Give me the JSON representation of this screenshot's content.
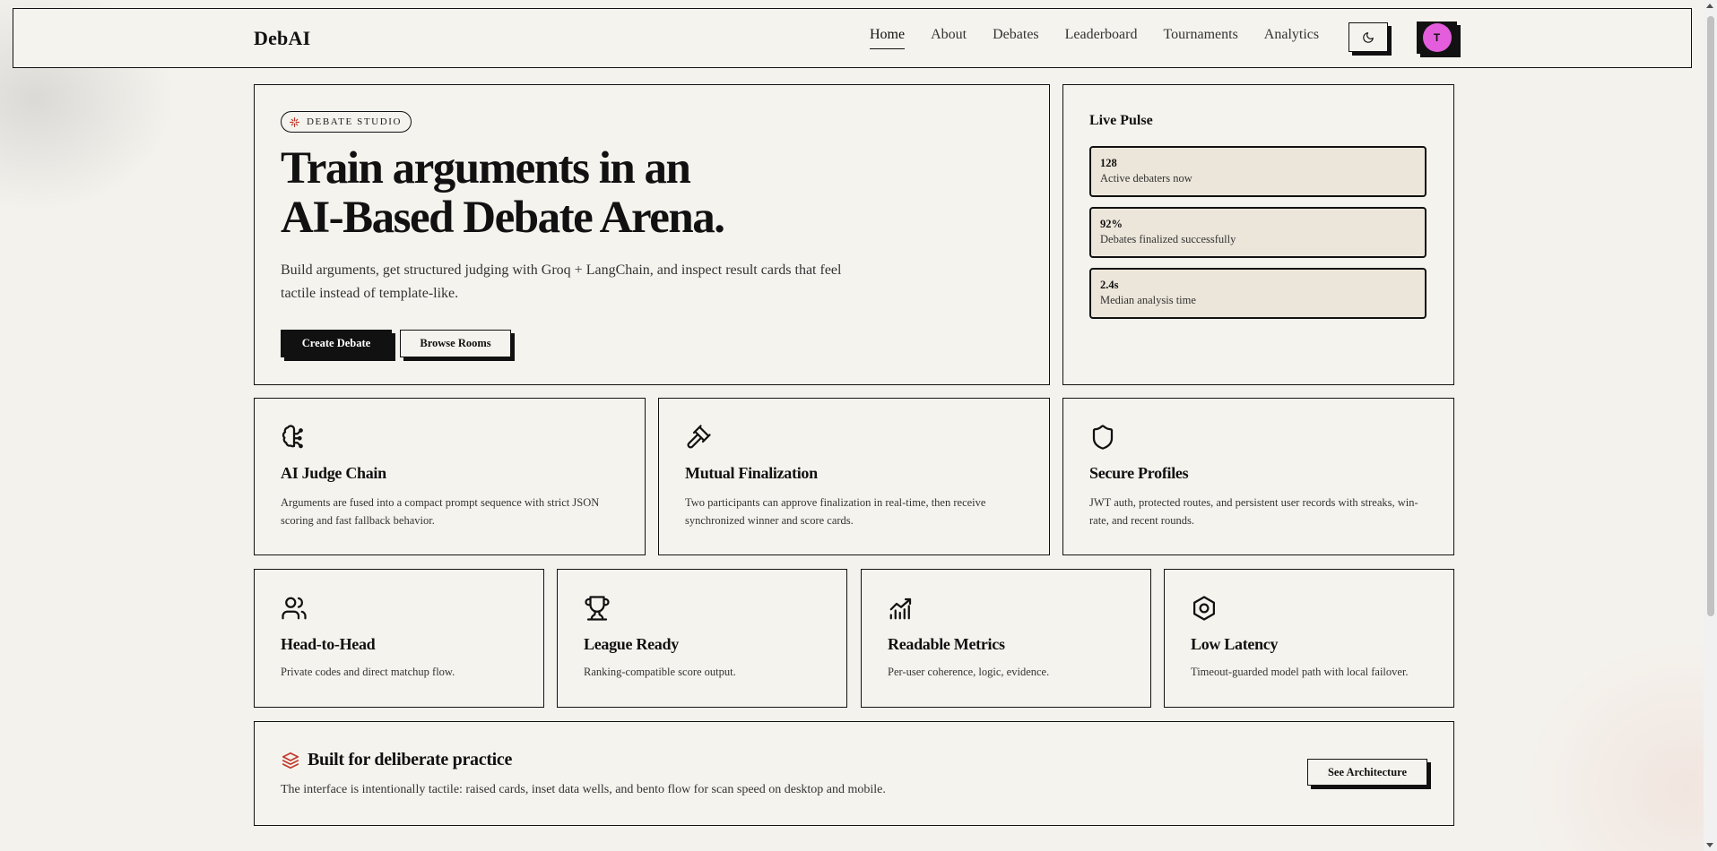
{
  "brand": "DebAI",
  "nav": {
    "links": [
      "Home",
      "About",
      "Debates",
      "Leaderboard",
      "Tournaments",
      "Analytics"
    ],
    "active": "Home",
    "theme_icon": "moon-icon",
    "avatar_initial": "T",
    "avatar_color": "#e45ddc"
  },
  "hero": {
    "badge": "DEBATE STUDIO",
    "badge_icon": "sparkle-icon",
    "title_line1": "Train arguments in an",
    "title_line2": "AI-Based Debate Arena.",
    "subtitle": "Build arguments, get structured judging with Groq + LangChain, and inspect result cards that feel tactile instead of template-like.",
    "primary_button": "Create Debate",
    "secondary_button": "Browse Rooms"
  },
  "pulse": {
    "title": "Live Pulse",
    "stats": [
      {
        "value": "128",
        "label": "Active debaters now"
      },
      {
        "value": "92%",
        "label": "Debates finalized successfully"
      },
      {
        "value": "2.4s",
        "label": "Median analysis time"
      }
    ]
  },
  "features_row1": [
    {
      "icon": "brain-icon",
      "title": "AI Judge Chain",
      "text": "Arguments are fused into a compact prompt sequence with strict JSON scoring and fast fallback behavior."
    },
    {
      "icon": "gavel-icon",
      "title": "Mutual Finalization",
      "text": "Two participants can approve finalization in real-time, then receive synchronized winner and score cards."
    },
    {
      "icon": "shield-icon",
      "title": "Secure Profiles",
      "text": "JWT auth, protected routes, and persistent user records with streaks, win-rate, and recent rounds."
    }
  ],
  "features_row2": [
    {
      "icon": "users-icon",
      "title": "Head-to-Head",
      "text": "Private codes and direct matchup flow."
    },
    {
      "icon": "trophy-icon",
      "title": "League Ready",
      "text": "Ranking-compatible score output."
    },
    {
      "icon": "chart-icon",
      "title": "Readable Metrics",
      "text": "Per-user coherence, logic, evidence."
    },
    {
      "icon": "hexagon-icon",
      "title": "Low Latency",
      "text": "Timeout-guarded model path with local failover."
    }
  ],
  "bottom": {
    "icon": "layers-icon",
    "title": "Built for deliberate practice",
    "text": "The interface is intentionally tactile: raised cards, inset data wells, and bento flow for scan speed on desktop and mobile.",
    "button": "See Architecture"
  },
  "colors": {
    "background": "#f4f2ed",
    "ink": "#111111",
    "accent_red": "#c0392b",
    "stat_well": "#ece6da"
  }
}
